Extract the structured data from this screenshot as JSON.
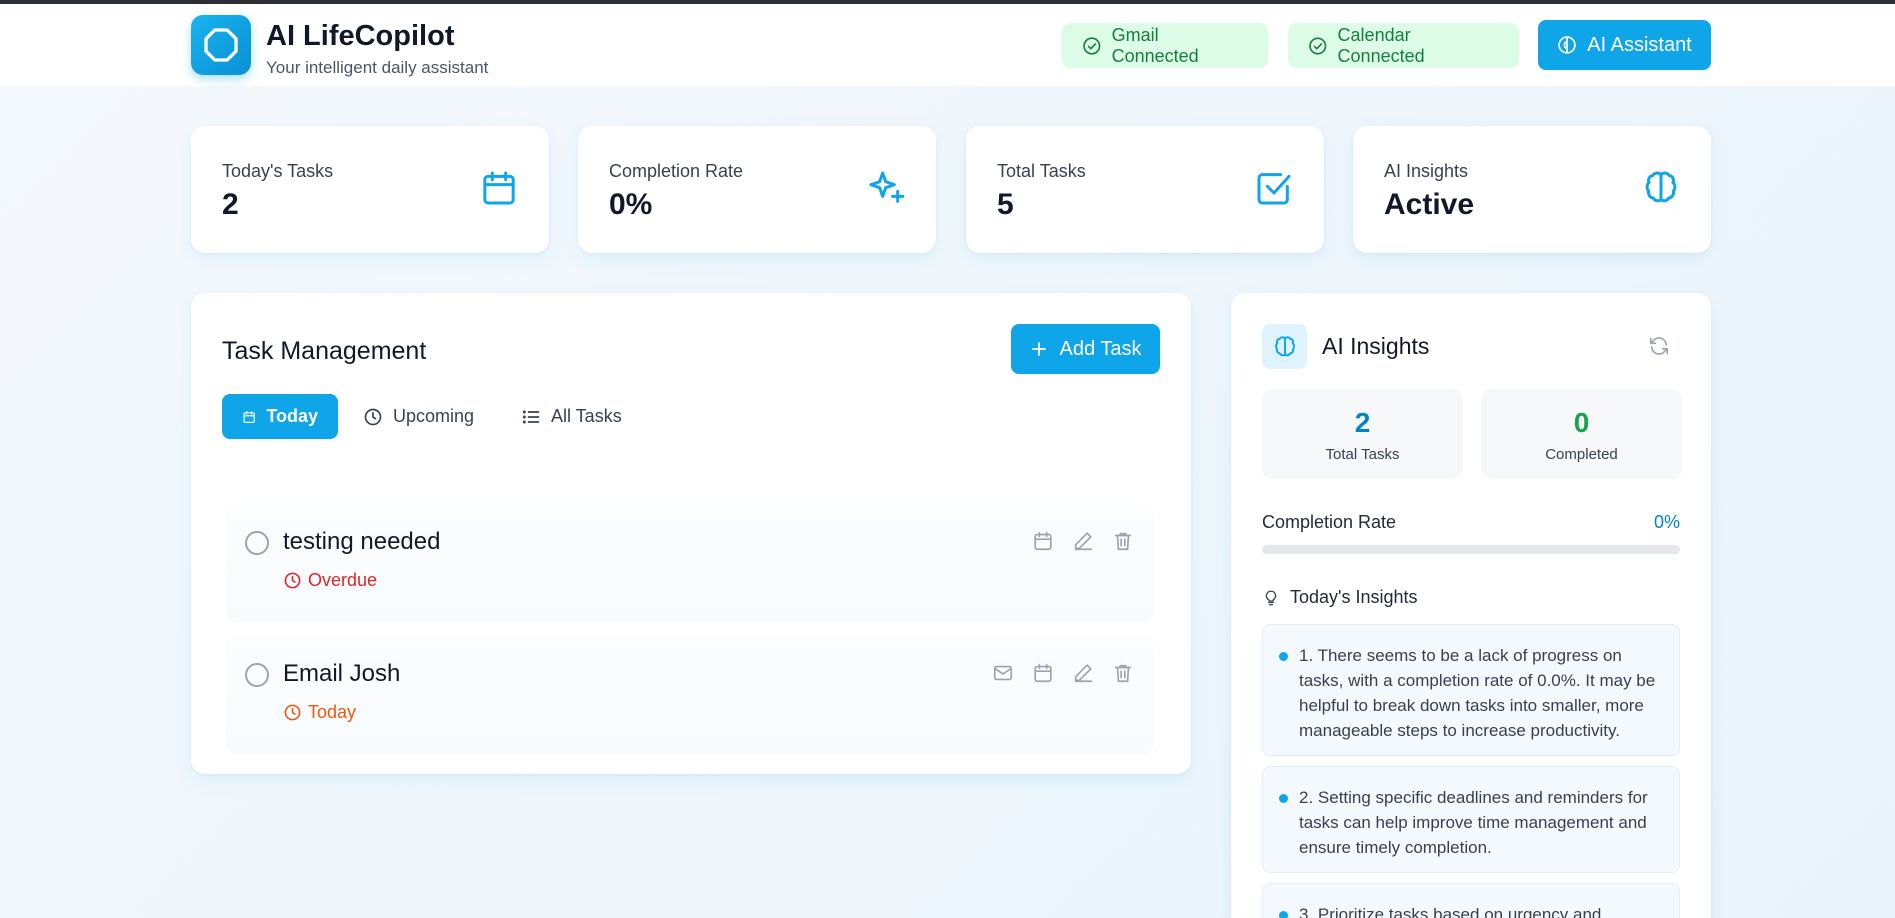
{
  "header": {
    "title": "AI LifeCopilot",
    "subtitle": "Your intelligent daily assistant",
    "gmail_status": "Gmail Connected",
    "calendar_status": "Calendar Connected",
    "assistant_label": "AI Assistant"
  },
  "stats": [
    {
      "label": "Today's Tasks",
      "value": "2",
      "icon": "calendar-icon"
    },
    {
      "label": "Completion Rate",
      "value": "0%",
      "icon": "sparkles-icon"
    },
    {
      "label": "Total Tasks",
      "value": "5",
      "icon": "check-square-icon"
    },
    {
      "label": "AI Insights",
      "value": "Active",
      "icon": "brain-icon"
    }
  ],
  "tasks_panel": {
    "title": "Task Management",
    "add_label": "Add Task",
    "tabs": [
      {
        "label": "Today",
        "active": true
      },
      {
        "label": "Upcoming",
        "active": false
      },
      {
        "label": "All Tasks",
        "active": false
      }
    ],
    "tasks": [
      {
        "title": "testing needed",
        "due": "Overdue",
        "due_color": "#dc2626"
      },
      {
        "title": "Email Josh",
        "due": "Today",
        "due_color": "#ea580c"
      }
    ]
  },
  "insights_panel": {
    "title": "AI Insights",
    "total_tasks": "2",
    "total_tasks_label": "Total Tasks",
    "completed": "0",
    "completed_label": "Completed",
    "completion_rate_label": "Completion Rate",
    "completion_rate": "0%",
    "completion_fraction": 0,
    "todays_insights_label": "Today's Insights",
    "insights": [
      "1. There seems to be a lack of progress on tasks, with a completion rate of 0.0%. It may be helpful to break down tasks into smaller, more manageable steps to increase productivity.",
      "2. Setting specific deadlines and reminders for tasks can help improve time management and ensure timely completion.",
      "3. Prioritize tasks based on urgency and"
    ]
  },
  "colors": {
    "accent": "#0ea5e9",
    "success_bg": "#dcfce7",
    "success_text": "#15803d",
    "overdue": "#dc2626",
    "today": "#ea580c",
    "completed_num": "#16a34a",
    "total_num": "#0284c7"
  }
}
